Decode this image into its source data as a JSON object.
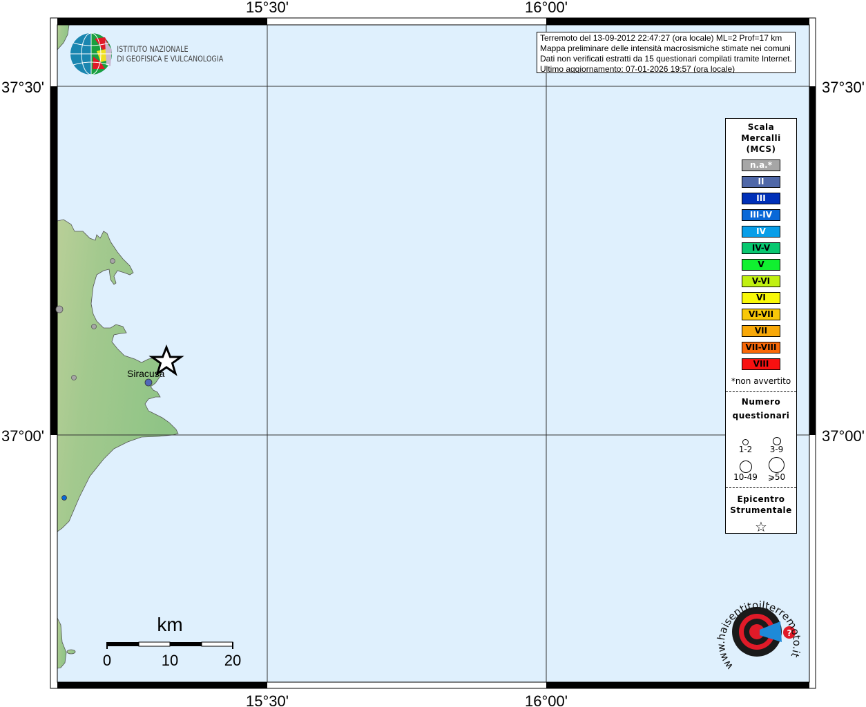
{
  "map": {
    "lon_ticks": [
      "15°30'",
      "16°00'"
    ],
    "lat_ticks": [
      "37°30'",
      "37°00'"
    ],
    "city": "Siracusa",
    "scale": {
      "unit": "km",
      "labels": [
        "0",
        "10",
        "20"
      ]
    },
    "sea_color": "#dff0fd",
    "land_color": "#9cc78c"
  },
  "logo_ingv": {
    "line1": "ISTITUTO NAZIONALE",
    "line2": "DI GEOFISICA E VULCANOLOGIA"
  },
  "logo_hsnt": {
    "text": "www.haisentitoilterremoto.it"
  },
  "info": {
    "lines": [
      "Terremoto del 13-09-2012 22:47:27 (ora locale) ML=2 Prof=17 km",
      "Mappa preliminare delle intensità macrosismiche stimate nei comuni",
      "Dati non verificati estratti da 15 questionari compilati tramite Internet.",
      "Ultimo aggiornamento: 07-01-2026 19:57 (ora locale)"
    ]
  },
  "legend": {
    "title": [
      "Scala",
      "Mercalli",
      "(MCS)"
    ],
    "items": [
      {
        "label": "n.a.*",
        "color": "#a6a6a6",
        "text": "#ffffff"
      },
      {
        "label": "II",
        "color": "#5068a8",
        "text": "#ffffff"
      },
      {
        "label": "III",
        "color": "#0030b8",
        "text": "#ffffff"
      },
      {
        "label": "III-IV",
        "color": "#0868d8",
        "text": "#ffffff"
      },
      {
        "label": "IV",
        "color": "#089ee8",
        "text": "#ffffff"
      },
      {
        "label": "IV-V",
        "color": "#08c870",
        "text": "#000000"
      },
      {
        "label": "V",
        "color": "#10f030",
        "text": "#000000"
      },
      {
        "label": "V-VI",
        "color": "#c0f010",
        "text": "#000000"
      },
      {
        "label": "VI",
        "color": "#f8f808",
        "text": "#000000"
      },
      {
        "label": "VI-VII",
        "color": "#f8c808",
        "text": "#000000"
      },
      {
        "label": "VII",
        "color": "#f8a808",
        "text": "#000000"
      },
      {
        "label": "VII-VIII",
        "color": "#f86808",
        "text": "#000000"
      },
      {
        "label": "VIII",
        "color": "#f81010",
        "text": "#000000"
      }
    ],
    "note": "*non avvertito",
    "questionari_title": [
      "Numero",
      "questionari"
    ],
    "sizes": [
      "1-2",
      "3-9",
      "10-49",
      "⩾50"
    ],
    "epicentro_title": [
      "Epicentro",
      "Strumentale"
    ],
    "star": "☆"
  }
}
